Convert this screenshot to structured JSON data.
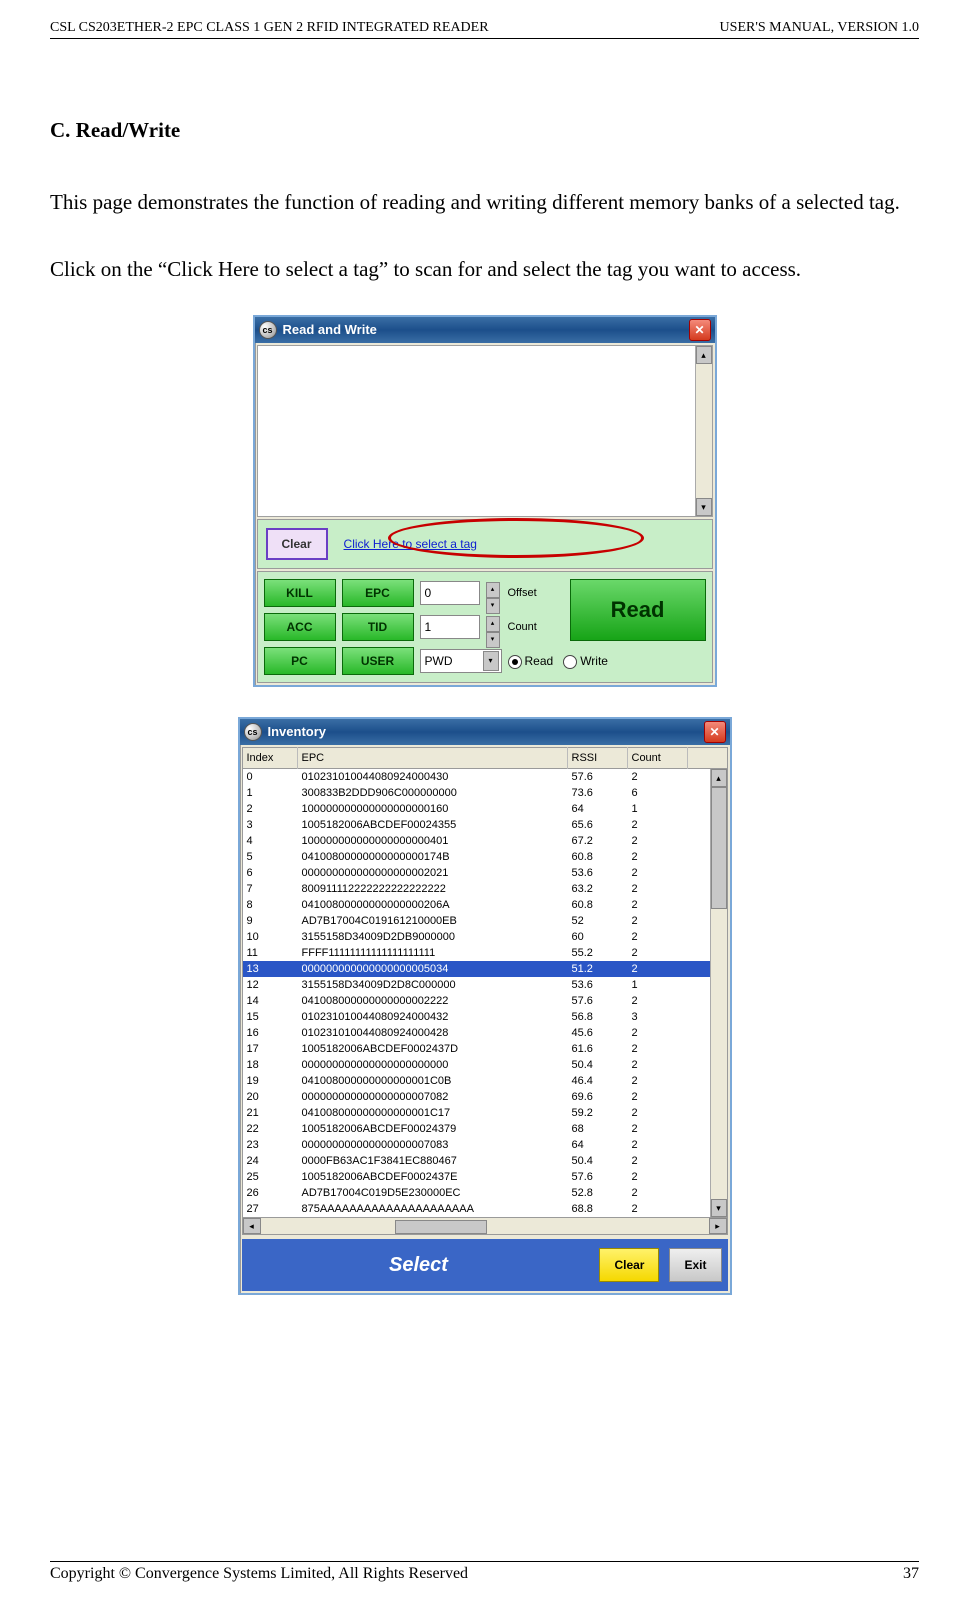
{
  "header": {
    "left": "CSL CS203ETHER-2 EPC CLASS 1 GEN 2 RFID INTEGRATED READER",
    "right": "USER'S  MANUAL,  VERSION  1.0"
  },
  "section_title": "C.  Read/Write",
  "para1": "This page demonstrates the function of reading and writing different memory banks of a selected tag.",
  "para2": "Click on the “Click Here to select a tag” to scan for and select the tag you want to access.",
  "rw": {
    "title": "Read and Write",
    "clear": "Clear",
    "link": "Click Here to select a tag",
    "buttons": {
      "kill": "KILL",
      "epc": "EPC",
      "acc": "ACC",
      "tid": "TID",
      "pc": "PC",
      "user": "USER"
    },
    "offset_value": "0",
    "offset_label": "Offset",
    "count_value": "1",
    "count_label": "Count",
    "combo_value": "PWD",
    "read_big": "Read",
    "radio_read": "Read",
    "radio_write": "Write"
  },
  "inv": {
    "title": "Inventory",
    "columns": [
      "Index",
      "EPC",
      "RSSI",
      "Count"
    ],
    "selected_index": 13,
    "rows": [
      {
        "i": "0",
        "e": "010231010044080924000430",
        "r": "57.6",
        "c": "2"
      },
      {
        "i": "1",
        "e": "300833B2DDD906C000000000",
        "r": "73.6",
        "c": "6"
      },
      {
        "i": "2",
        "e": "100000000000000000000160",
        "r": "64",
        "c": "1"
      },
      {
        "i": "3",
        "e": "1005182006ABCDEF00024355",
        "r": "65.6",
        "c": "2"
      },
      {
        "i": "4",
        "e": "100000000000000000000401",
        "r": "67.2",
        "c": "2"
      },
      {
        "i": "5",
        "e": "04100800000000000000174B",
        "r": "60.8",
        "c": "2"
      },
      {
        "i": "6",
        "e": "000000000000000000002021",
        "r": "53.6",
        "c": "2"
      },
      {
        "i": "7",
        "e": "800911112222222222222222",
        "r": "63.2",
        "c": "2"
      },
      {
        "i": "8",
        "e": "04100800000000000000206A",
        "r": "60.8",
        "c": "2"
      },
      {
        "i": "9",
        "e": "AD7B17004C019161210000EB",
        "r": "52",
        "c": "2"
      },
      {
        "i": "10",
        "e": "3155158D34009D2DB9000000",
        "r": "60",
        "c": "2"
      },
      {
        "i": "11",
        "e": "FFFF11111111111111111111",
        "r": "55.2",
        "c": "2"
      },
      {
        "i": "13",
        "e": "000000000000000000005034",
        "r": "51.2",
        "c": "2"
      },
      {
        "i": "12",
        "e": "3155158D34009D2D8C000000",
        "r": "53.6",
        "c": "1"
      },
      {
        "i": "14",
        "e": "041008000000000000002222",
        "r": "57.6",
        "c": "2"
      },
      {
        "i": "15",
        "e": "010231010044080924000432",
        "r": "56.8",
        "c": "3"
      },
      {
        "i": "16",
        "e": "010231010044080924000428",
        "r": "45.6",
        "c": "2"
      },
      {
        "i": "17",
        "e": "1005182006ABCDEF0002437D",
        "r": "61.6",
        "c": "2"
      },
      {
        "i": "18",
        "e": "000000000000000000000000",
        "r": "50.4",
        "c": "2"
      },
      {
        "i": "19",
        "e": "041008000000000000001C0B",
        "r": "46.4",
        "c": "2"
      },
      {
        "i": "20",
        "e": "000000000000000000007082",
        "r": "69.6",
        "c": "2"
      },
      {
        "i": "21",
        "e": "041008000000000000001C17",
        "r": "59.2",
        "c": "2"
      },
      {
        "i": "22",
        "e": "1005182006ABCDEF00024379",
        "r": "68",
        "c": "2"
      },
      {
        "i": "23",
        "e": "000000000000000000007083",
        "r": "64",
        "c": "2"
      },
      {
        "i": "24",
        "e": "0000FB63AC1F3841EC880467",
        "r": "50.4",
        "c": "2"
      },
      {
        "i": "25",
        "e": "1005182006ABCDEF0002437E",
        "r": "57.6",
        "c": "2"
      },
      {
        "i": "26",
        "e": "AD7B17004C019D5E230000EC",
        "r": "52.8",
        "c": "2"
      },
      {
        "i": "27",
        "e": "875AAAAAAAAAAAAAAAAAAAAA",
        "r": "68.8",
        "c": "2"
      }
    ],
    "select": "Select",
    "clear": "Clear",
    "exit": "Exit"
  },
  "footer": {
    "left": "Copyright © Convergence Systems Limited, All Rights Reserved",
    "right": "37"
  }
}
